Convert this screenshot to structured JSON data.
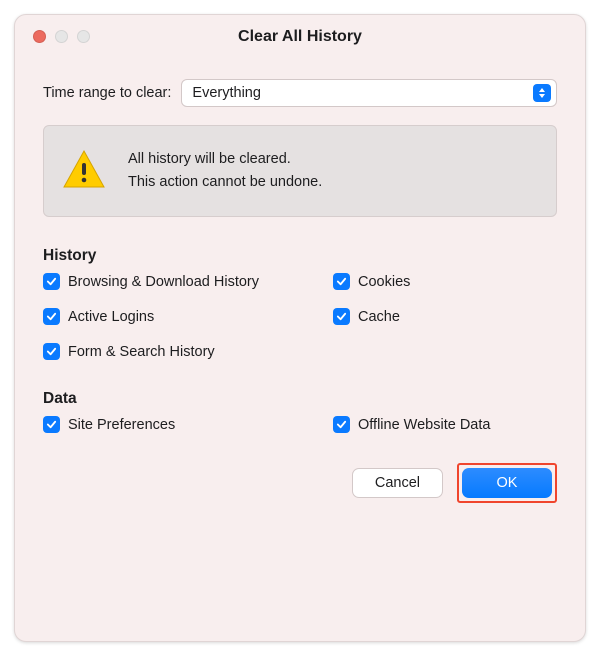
{
  "title": "Clear All History",
  "range": {
    "label": "Time range to clear:",
    "value": "Everything"
  },
  "warning": {
    "line1": "All history will be cleared.",
    "line2": "This action cannot be undone."
  },
  "sections": {
    "history": {
      "heading": "History",
      "items": {
        "browsing": "Browsing & Download History",
        "cookies": "Cookies",
        "activeLogins": "Active Logins",
        "cache": "Cache",
        "formSearch": "Form & Search History"
      }
    },
    "data": {
      "heading": "Data",
      "items": {
        "sitePrefs": "Site Preferences",
        "offline": "Offline Website Data"
      }
    }
  },
  "buttons": {
    "cancel": "Cancel",
    "ok": "OK"
  }
}
